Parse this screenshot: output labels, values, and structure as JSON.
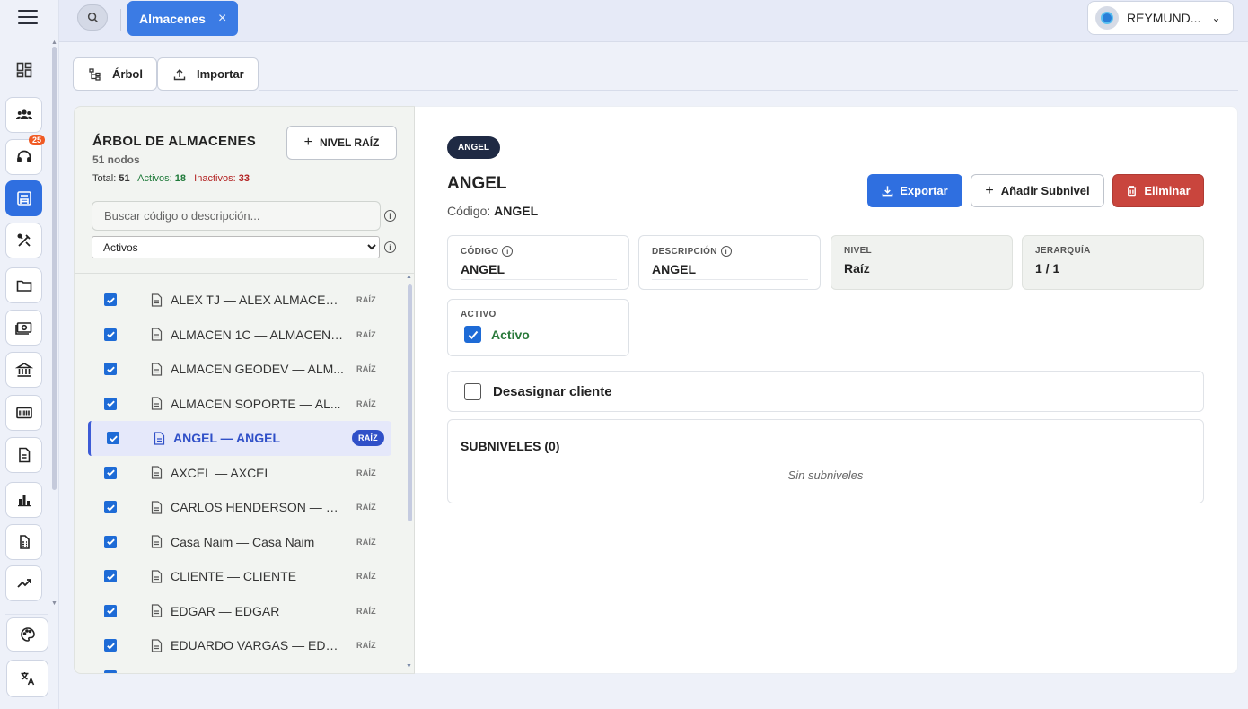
{
  "topbar": {
    "tab_label": "Almacenes",
    "tab_close": "×",
    "user_name": "REYMUND...",
    "user_chevron": "⌄"
  },
  "sidebar": {
    "items": [
      {
        "icon": "dashboard-icon"
      },
      {
        "icon": "users-icon"
      },
      {
        "icon": "headset-icon",
        "badge": "25"
      },
      {
        "icon": "warehouse-icon",
        "active": true
      },
      {
        "icon": "tools-icon"
      },
      {
        "icon": "folder-icon"
      },
      {
        "icon": "cash-icon"
      },
      {
        "icon": "bank-icon"
      },
      {
        "icon": "barcode-icon"
      },
      {
        "icon": "document-icon"
      },
      {
        "icon": "bar-chart-icon"
      },
      {
        "icon": "calculator-icon"
      },
      {
        "icon": "trending-up-icon"
      },
      {
        "icon": "palette-icon"
      },
      {
        "icon": "translate-icon"
      }
    ]
  },
  "toolbar": {
    "arbol_label": "Árbol",
    "importar_label": "Importar"
  },
  "tree": {
    "title": "ÁRBOL DE ALMACENES",
    "count": "51 nodos",
    "total_label": "Total:",
    "total_value": "51",
    "activos_label": "Activos:",
    "activos_value": "18",
    "inactivos_label": "Inactivos:",
    "inactivos_value": "33",
    "nivel_raiz_label": "NIVEL RAÍZ",
    "search_placeholder": "Buscar código o descripción...",
    "filter_value": "Activos",
    "filter_options": [
      "Activos"
    ],
    "info_glyph": "i",
    "items": [
      {
        "label": "ALEX TJ — ALEX ALMACEN...",
        "tag": "RAÍZ"
      },
      {
        "label": "ALMACEN 1C — ALMACEN ...",
        "tag": "RAÍZ"
      },
      {
        "label": "ALMACEN GEODEV — ALM...",
        "tag": "RAÍZ"
      },
      {
        "label": "ALMACEN SOPORTE — AL...",
        "tag": "RAÍZ"
      },
      {
        "label": "ANGEL — ANGEL",
        "tag": "RAÍZ",
        "selected": true
      },
      {
        "label": "AXCEL — AXCEL",
        "tag": "RAÍZ"
      },
      {
        "label": "CARLOS HENDERSON — C...",
        "tag": "RAÍZ"
      },
      {
        "label": "Casa Naim — Casa Naim",
        "tag": "RAÍZ"
      },
      {
        "label": "CLIENTE — CLIENTE",
        "tag": "RAÍZ"
      },
      {
        "label": "EDGAR — EDGAR",
        "tag": "RAÍZ"
      },
      {
        "label": "EDUARDO VARGAS — EDU...",
        "tag": "RAÍZ"
      },
      {
        "label": "",
        "tag": ""
      }
    ]
  },
  "detail": {
    "chip": "ANGEL",
    "title": "ANGEL",
    "codigo_prefix": "Código:",
    "codigo_value": "ANGEL",
    "export_label": "Exportar",
    "add_sub_label": "Añadir Subnivel",
    "delete_label": "Eliminar",
    "fields": {
      "codigo_label": "CÓDIGO",
      "codigo_value": "ANGEL",
      "descripcion_label": "DESCRIPCIÓN",
      "descripcion_value": "ANGEL",
      "nivel_label": "NIVEL",
      "nivel_value": "Raíz",
      "jerarquia_label": "JERARQUÍA",
      "jerarquia_value": "1 / 1"
    },
    "activo_label": "ACTIVO",
    "activo_value": "Activo",
    "desasignar_label": "Desasignar cliente",
    "subniveles_title": "SUBNIVELES (0)",
    "subniveles_empty": "Sin subniveles"
  }
}
